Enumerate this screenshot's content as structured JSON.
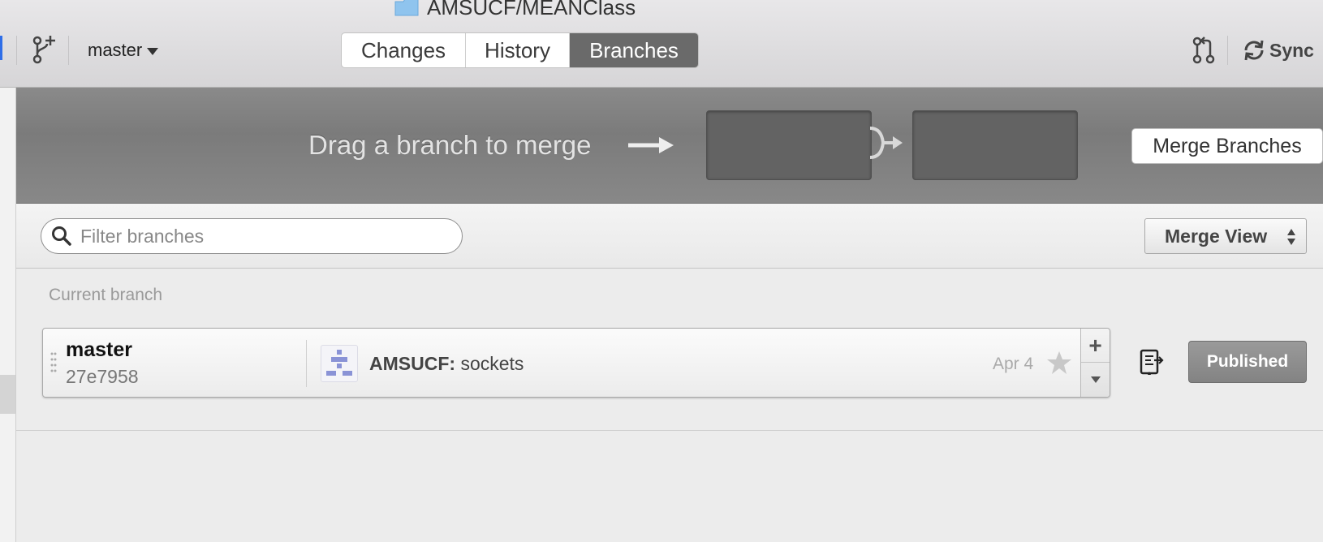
{
  "window": {
    "repo_title": "AMSUCF/MEANClass"
  },
  "toolbar": {
    "branch_selector": "master",
    "tabs": [
      {
        "label": "Changes",
        "active": false
      },
      {
        "label": "History",
        "active": false
      },
      {
        "label": "Branches",
        "active": true
      }
    ],
    "sync_label": "Sync"
  },
  "merge": {
    "hint": "Drag a branch to merge",
    "button_label": "Merge Branches"
  },
  "filter": {
    "placeholder": "Filter branches",
    "value": "",
    "view_select": "Merge View"
  },
  "branches": {
    "section_label": "Current branch",
    "current": {
      "name": "master",
      "sha": "27e7958",
      "commit_author": "AMSUCF:",
      "commit_message": "sockets",
      "date": "Apr 4",
      "status": "Published"
    }
  },
  "colors": {
    "active_tab": "#6a6a6a",
    "merge_bar": "#828282",
    "published_button": "#8e8e8e",
    "accent_blue": "#2f6ee8"
  }
}
